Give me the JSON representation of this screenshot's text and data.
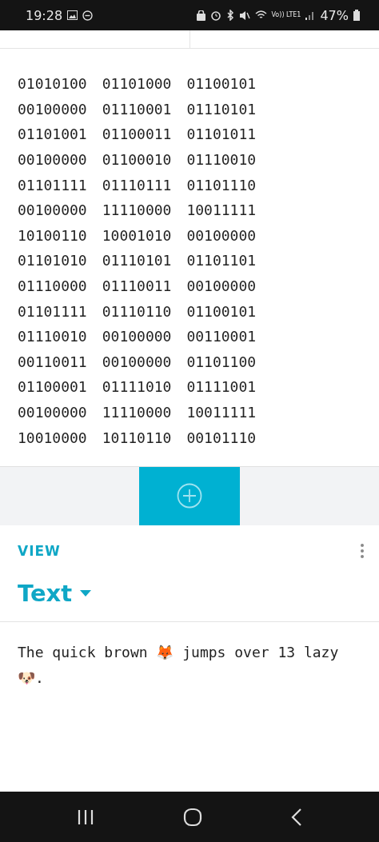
{
  "status_bar": {
    "time": "19:28",
    "battery_text": "47%",
    "network_text": "Vo)) LTE1"
  },
  "binary_output": {
    "rows": [
      [
        "01010100",
        "01101000",
        "01100101"
      ],
      [
        "00100000",
        "01110001",
        "01110101"
      ],
      [
        "01101001",
        "01100011",
        "01101011"
      ],
      [
        "00100000",
        "01100010",
        "01110010"
      ],
      [
        "01101111",
        "01110111",
        "01101110"
      ],
      [
        "00100000",
        "11110000",
        "10011111"
      ],
      [
        "10100110",
        "10001010",
        "00100000"
      ],
      [
        "01101010",
        "01110101",
        "01101101"
      ],
      [
        "01110000",
        "01110011",
        "00100000"
      ],
      [
        "01101111",
        "01110110",
        "01100101"
      ],
      [
        "01110010",
        "00100000",
        "00110001"
      ],
      [
        "00110011",
        "00100000",
        "01101100"
      ],
      [
        "01100001",
        "01111010",
        "01111001"
      ],
      [
        "00100000",
        "11110000",
        "10011111"
      ],
      [
        "10010000",
        "10110110",
        "00101110"
      ]
    ]
  },
  "view": {
    "section_label": "VIEW",
    "mode": "Text",
    "output": "The quick brown 🦊 jumps over 13 lazy 🐶."
  }
}
